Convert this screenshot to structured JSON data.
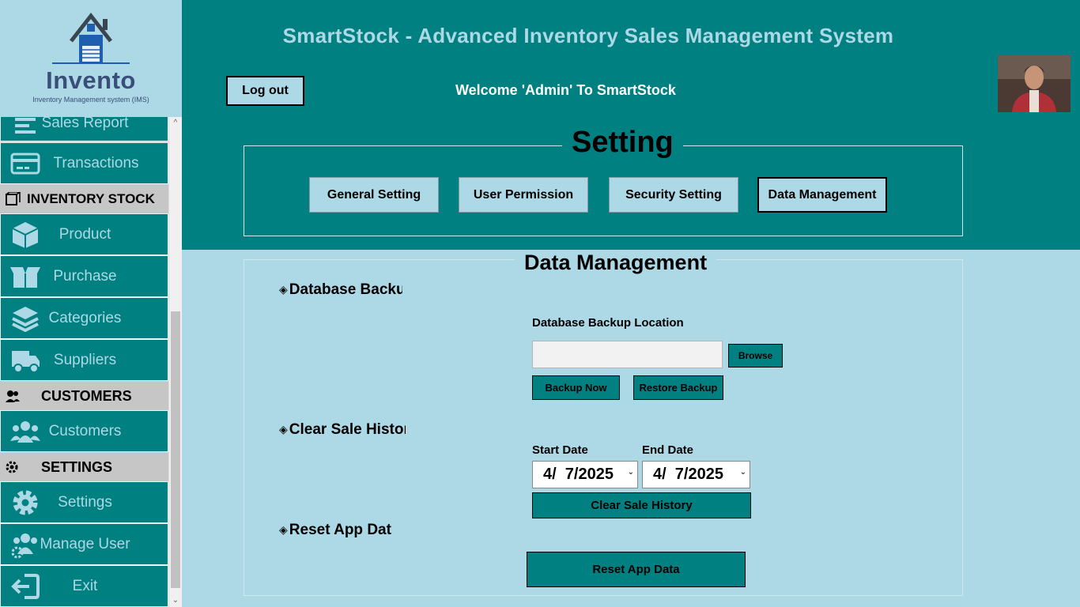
{
  "app": {
    "title": "SmartStock - Advanced Inventory  Sales Management System",
    "welcome": "Welcome 'Admin' To SmartStock",
    "logout_label": "Log out"
  },
  "logo": {
    "title": "Invento",
    "subtitle": "Inventory Management system (IMS)"
  },
  "sidebar": {
    "items": [
      {
        "label": "Sales Report",
        "icon": "report-icon"
      },
      {
        "label": "Transactions",
        "icon": "credit-card-icon"
      },
      {
        "label": "Product",
        "icon": "box-icon"
      },
      {
        "label": "Purchase",
        "icon": "open-box-icon"
      },
      {
        "label": "Categories",
        "icon": "layers-icon"
      },
      {
        "label": "Suppliers",
        "icon": "truck-icon"
      },
      {
        "label": "Customers",
        "icon": "users-icon"
      },
      {
        "label": "Settings",
        "icon": "gear-icon"
      },
      {
        "label": "Manage User",
        "icon": "user-gear-icon"
      },
      {
        "label": "Exit",
        "icon": "exit-icon"
      }
    ],
    "sections": [
      {
        "label": "INVENTORY  STOCK",
        "icon": "stock-icon"
      },
      {
        "label": "CUSTOMERS",
        "icon": "customers-icon"
      },
      {
        "label": "SETTINGS",
        "icon": "settings-icon"
      }
    ]
  },
  "setting": {
    "title": "Setting",
    "tabs": [
      "General Setting",
      "User Permission",
      "Security Setting",
      "Data Management"
    ],
    "active_tab": "Data Management"
  },
  "data_management": {
    "title": "Data Management",
    "backup": {
      "section_label": "Database Backu",
      "location_label": "Database Backup Location",
      "location_value": "",
      "browse_label": "Browse",
      "backup_now_label": "Backup Now",
      "restore_label": "Restore Backup"
    },
    "clear_history": {
      "section_label": "Clear Sale Histoı",
      "start_label": "Start Date",
      "end_label": "End Date",
      "start_value": "4/  7/2025",
      "end_value": "4/  7/2025",
      "button_label": "Clear Sale History"
    },
    "reset": {
      "section_label": "Reset App Dat",
      "button_label": "Reset App Data"
    }
  },
  "colors": {
    "teal": "#008080",
    "light_blue": "#add8e6",
    "section_grey": "#c6c6c6"
  }
}
